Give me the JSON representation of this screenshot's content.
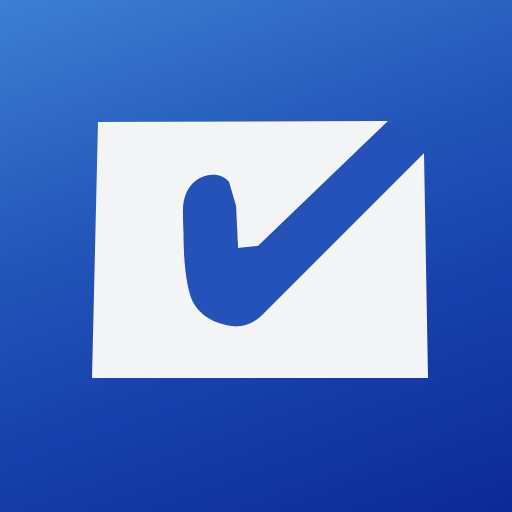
{
  "icon": {
    "name": "checkbox-check-icon",
    "colors": {
      "background_top": "#3d7fd3",
      "background_bottom": "#0c2a98",
      "box": "#f3f4f6",
      "check": "#2452b8"
    }
  }
}
